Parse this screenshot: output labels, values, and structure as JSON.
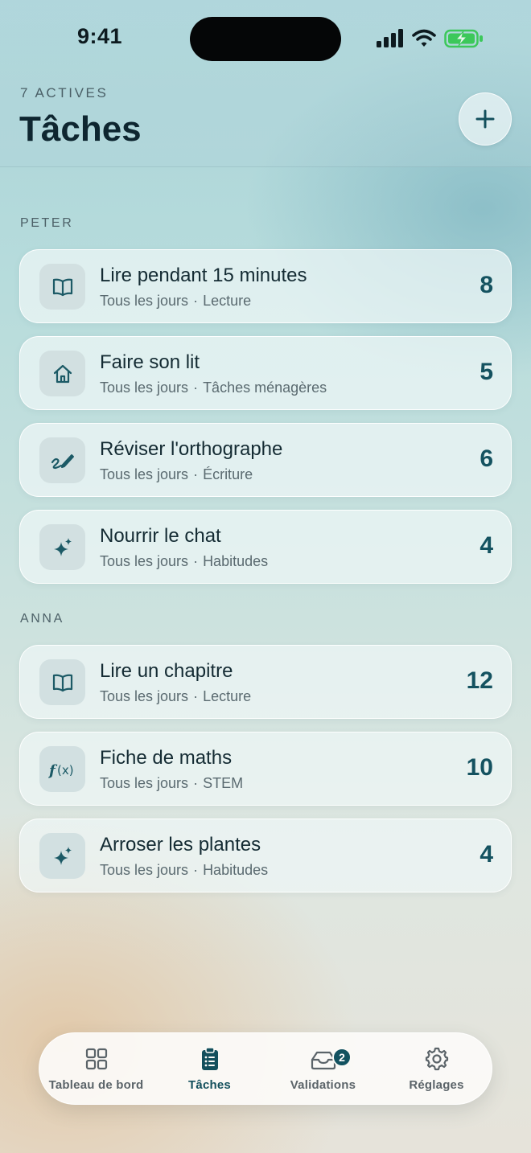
{
  "status_bar": {
    "time": "9:41"
  },
  "header": {
    "kicker": "7 ACTIVES",
    "title": "Tâches",
    "add_icon": "plus-icon"
  },
  "sections": [
    {
      "label": "PETER",
      "tasks": [
        {
          "title": "Lire pendant 15 minutes",
          "frequency": "Tous les jours",
          "category": "Lecture",
          "points": "8",
          "icon": "book-icon"
        },
        {
          "title": "Faire son lit",
          "frequency": "Tous les jours",
          "category": "Tâches ménagères",
          "points": "5",
          "icon": "home-icon"
        },
        {
          "title": "Réviser l'orthographe",
          "frequency": "Tous les jours",
          "category": "Écriture",
          "points": "6",
          "icon": "pencil-icon"
        },
        {
          "title": "Nourrir le chat",
          "frequency": "Tous les jours",
          "category": "Habitudes",
          "points": "4",
          "icon": "sparkle-icon"
        }
      ]
    },
    {
      "label": "ANNA",
      "tasks": [
        {
          "title": "Lire un chapitre",
          "frequency": "Tous les jours",
          "category": "Lecture",
          "points": "12",
          "icon": "book-icon"
        },
        {
          "title": "Fiche de maths",
          "frequency": "Tous les jours",
          "category": "STEM",
          "points": "10",
          "icon": "function-icon"
        },
        {
          "title": "Arroser les plantes",
          "frequency": "Tous les jours",
          "category": "Habitudes",
          "points": "4",
          "icon": "sparkle-icon"
        }
      ]
    }
  ],
  "tab_bar": {
    "tabs": [
      {
        "label": "Tableau de bord",
        "icon": "grid-icon",
        "active": false
      },
      {
        "label": "Tâches",
        "icon": "clipboard-list-icon",
        "active": true
      },
      {
        "label": "Validations",
        "icon": "tray-icon",
        "active": false,
        "badge": "2"
      },
      {
        "label": "Réglages",
        "icon": "gear-icon",
        "active": false
      }
    ]
  },
  "colors": {
    "accent": "#134f5c",
    "icon_tile": "#d2e0e1",
    "battery_green": "#3cc85a"
  }
}
